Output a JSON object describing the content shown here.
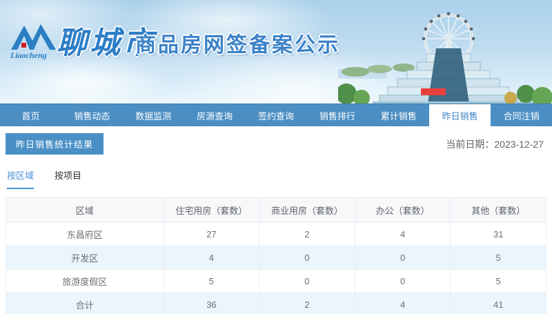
{
  "header": {
    "logo_script": "Liaocheng",
    "city_name": "聊城市",
    "site_title": "商品房网签备案公示"
  },
  "nav": {
    "items": [
      {
        "label": "首页",
        "active": false
      },
      {
        "label": "销售动态",
        "active": false
      },
      {
        "label": "数据监测",
        "active": false
      },
      {
        "label": "房源查询",
        "active": false
      },
      {
        "label": "签约查询",
        "active": false
      },
      {
        "label": "销售排行",
        "active": false
      },
      {
        "label": "累计销售",
        "active": false
      },
      {
        "label": "昨日销售",
        "active": true
      },
      {
        "label": "合同注销",
        "active": false
      }
    ]
  },
  "page": {
    "section_title": "昨日销售统计结果",
    "current_date": "当前日期：2023-12-27"
  },
  "tabs": [
    {
      "label": "按区域",
      "active": true
    },
    {
      "label": "按项目",
      "active": false
    }
  ],
  "table": {
    "columns": [
      "区域",
      "住宅用房（套数）",
      "商业用房（套数）",
      "办公（套数）",
      "其他（套数）"
    ],
    "rows": [
      [
        "东昌府区",
        "27",
        "2",
        "4",
        "31"
      ],
      [
        "开发区",
        "4",
        "0",
        "0",
        "5"
      ],
      [
        "旅游度假区",
        "5",
        "0",
        "0",
        "5"
      ],
      [
        "合计",
        "36",
        "2",
        "4",
        "41"
      ]
    ]
  },
  "colors": {
    "nav_blue": "#4b8ec3",
    "accent_blue": "#4a93d6",
    "section_bar_blue": "#4a90c6",
    "banner_title_blue": "#3b82c8",
    "zebra_row_blue": "#eaf5fc",
    "logo_red": "#cc1f1f"
  }
}
